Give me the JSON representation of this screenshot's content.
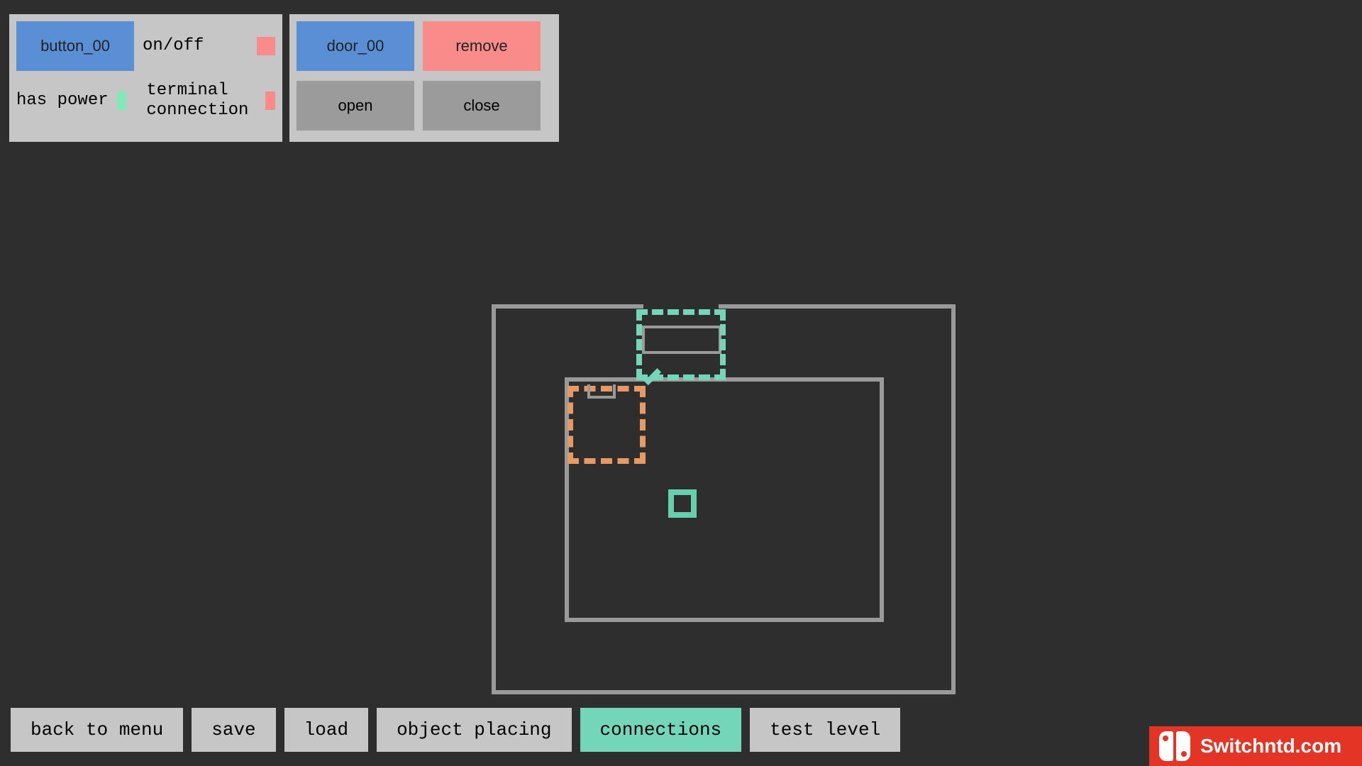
{
  "colors": {
    "bg": "#2e2e2e",
    "panel": "#c6c6c6",
    "blue": "#5a8fd6",
    "red": "#f98b8b",
    "gray": "#9b9b9b",
    "teal": "#74d6b8",
    "orange": "#e59a63",
    "wall": "#9a9a9a",
    "status_green": "#82e9b7",
    "status_red": "#f98b8b"
  },
  "panel_button": {
    "object_label": "button_00",
    "prop_onoff": "on/off",
    "prop_onoff_state": "off",
    "prop_power": "has power",
    "prop_power_state": "on",
    "prop_terminal": "terminal\nconnection",
    "prop_terminal_state": "off"
  },
  "panel_door": {
    "object_label": "door_00",
    "remove": "remove",
    "open": "open",
    "close": "close"
  },
  "toolbar": {
    "back": "back to menu",
    "save": "save",
    "load": "load",
    "place": "object placing",
    "conn": "connections",
    "test": "test level",
    "active": "conn"
  },
  "watermark": {
    "text": "Switchntd.com"
  }
}
